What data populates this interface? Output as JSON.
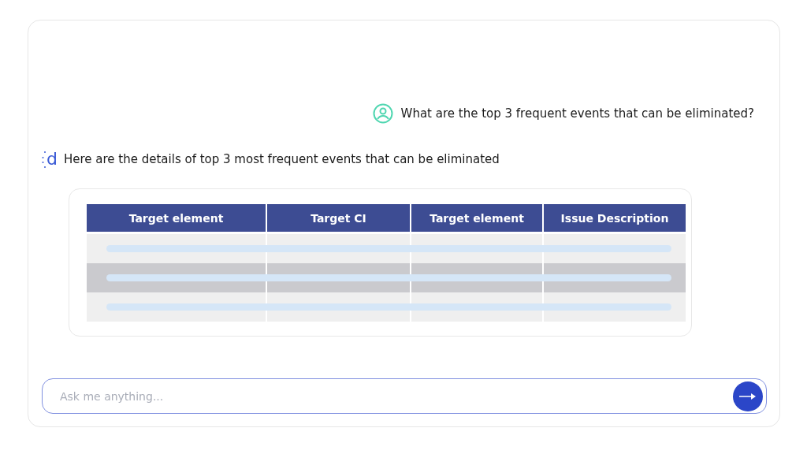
{
  "question": {
    "text": "What are the top 3 frequent events that can be eliminated?"
  },
  "answer": {
    "logo": "d",
    "text": "Here are the details of top 3 most frequent events that can be eliminated"
  },
  "table": {
    "columns": [
      "Target element",
      "Target CI",
      "Target element",
      "Issue Description"
    ],
    "rows": [
      {
        "selected": false
      },
      {
        "selected": true
      },
      {
        "selected": false
      }
    ]
  },
  "input": {
    "placeholder": "Ask me anything..."
  }
}
